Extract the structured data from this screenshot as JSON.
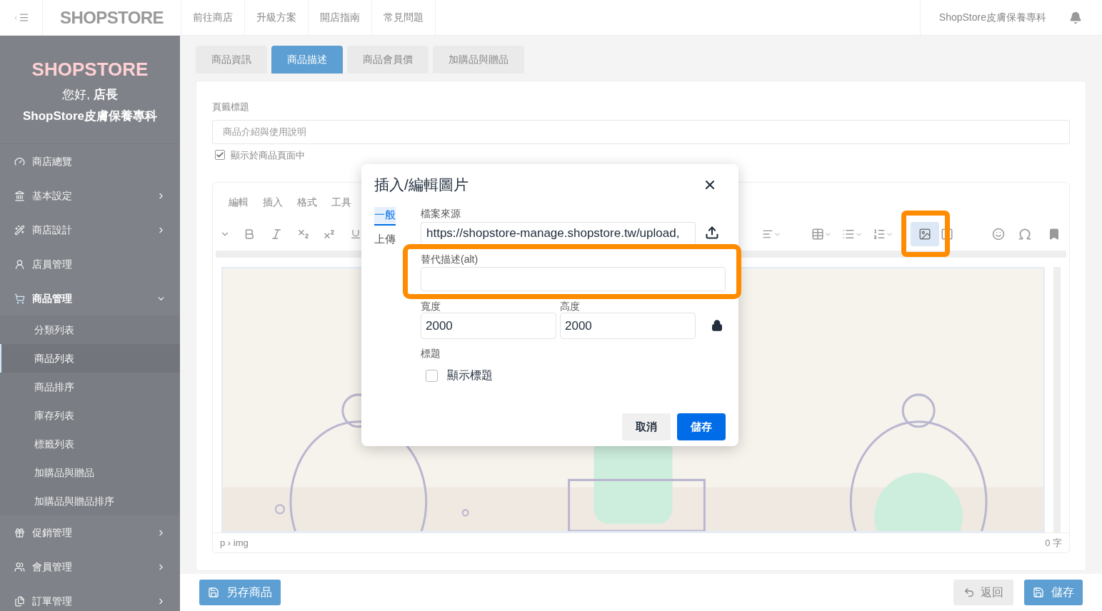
{
  "topbar": {
    "logo": "SHOPSTORE",
    "nav": [
      "前往商店",
      "升級方案",
      "開店指南",
      "常見問題"
    ],
    "store_name": "ShopStore皮膚保養專科"
  },
  "sidebar": {
    "logo": "SHOPSTORE",
    "greeting": "您好, **店長**",
    "store": "ShopStore皮膚保養專科",
    "items": [
      {
        "label": "商店總覽",
        "expandable": false,
        "expanded": false
      },
      {
        "label": "基本設定",
        "expandable": true,
        "expanded": false
      },
      {
        "label": "商店設計",
        "expandable": true,
        "expanded": false
      },
      {
        "label": "店員管理",
        "expandable": false,
        "expanded": false
      },
      {
        "label": "商品管理",
        "expandable": true,
        "expanded": true,
        "children": [
          {
            "label": "分類列表",
            "selected": false
          },
          {
            "label": "商品列表",
            "selected": true
          },
          {
            "label": "商品排序",
            "selected": false
          },
          {
            "label": "庫存列表",
            "selected": false
          },
          {
            "label": "標籤列表",
            "selected": false
          },
          {
            "label": "加購品與贈品",
            "selected": false
          },
          {
            "label": "加購品與贈品排序",
            "selected": false
          }
        ]
      },
      {
        "label": "促銷管理",
        "expandable": true,
        "expanded": false
      },
      {
        "label": "會員管理",
        "expandable": true,
        "expanded": false
      },
      {
        "label": "訂單管理",
        "expandable": true,
        "expanded": false
      }
    ]
  },
  "tabs": [
    {
      "label": "商品資訊",
      "selected": false
    },
    {
      "label": "商品描述",
      "selected": true
    },
    {
      "label": "商品會員價",
      "selected": false
    },
    {
      "label": "加購品與贈品",
      "selected": false
    }
  ],
  "form": {
    "label": "頁籤標題",
    "placeholder": "商品介紹與使用說明",
    "show_on_page": {
      "label": "顯示於商品頁面中",
      "checked": true
    }
  },
  "editor": {
    "menu": [
      "編輯",
      "插入",
      "格式",
      "工具"
    ],
    "image_tool": {
      "active": true,
      "highlighted": true
    },
    "path": "p › img",
    "count": "0 字"
  },
  "dialog": {
    "title": "插入/編輯圖片",
    "tabs": [
      {
        "label": "一般",
        "selected": true
      },
      {
        "label": "上傳",
        "selected": false
      }
    ],
    "source": {
      "label": "檔案來源",
      "value": "https://shopstore-manage.shopstore.tw/upload,"
    },
    "alt": {
      "label": "替代描述(alt)",
      "highlighted": true
    },
    "width": {
      "label": "寬度",
      "value": "2000"
    },
    "height": {
      "label": "高度",
      "value": "2000"
    },
    "caption": {
      "label": "標題",
      "checkbox": {
        "label": "顯示標題",
        "checked": false
      }
    },
    "buttons": [
      {
        "label": "取消",
        "kind": "secondary"
      },
      {
        "label": "儲存",
        "kind": "primary"
      }
    ]
  },
  "footer": {
    "save_as": "另存商品",
    "back": "返回",
    "save": "儲存"
  }
}
